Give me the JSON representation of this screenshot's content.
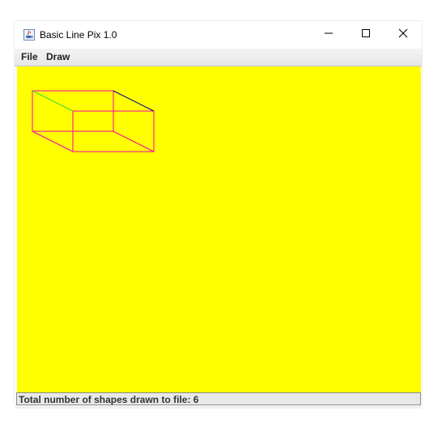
{
  "window": {
    "title": "Basic Line Pix 1.0",
    "icon": "java-cup-icon",
    "controls": [
      "minimize-icon",
      "maximize-icon",
      "close-icon"
    ]
  },
  "menubar": {
    "items": [
      "File",
      "Draw"
    ]
  },
  "canvas": {
    "background": "#ffff00",
    "shape": "wireframe-box",
    "edge_colors": [
      "#ff00aa",
      "#33dd33",
      "#000099"
    ]
  },
  "statusbar": {
    "text": "Total number of shapes drawn to file: 6"
  }
}
